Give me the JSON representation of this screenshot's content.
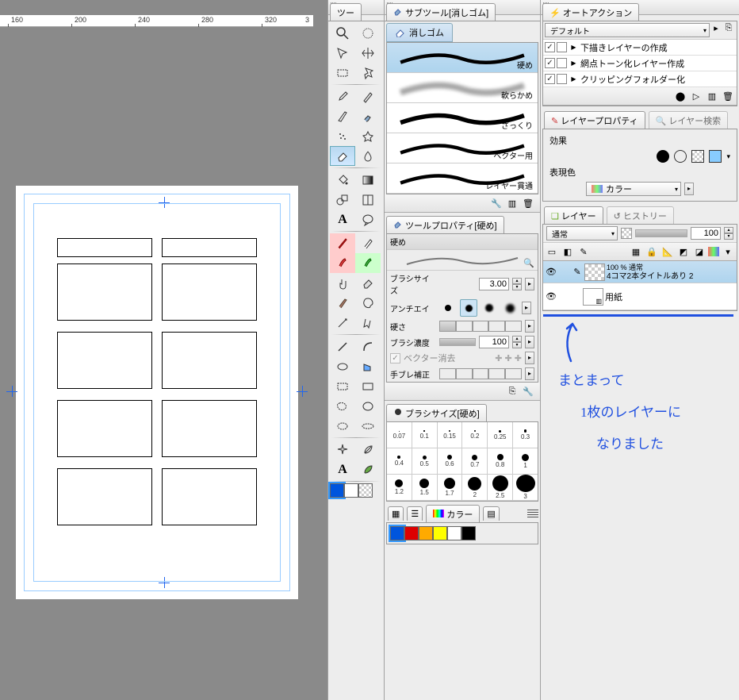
{
  "ruler": {
    "ticks": [
      "160",
      "200",
      "240",
      "280",
      "320"
    ]
  },
  "tool_panel": {
    "title": "ツー"
  },
  "subtool": {
    "title": "サブツール[消しゴム]",
    "tab": "消しゴム",
    "items": [
      "硬め",
      "軟らかめ",
      "ざっくり",
      "ベクター用",
      "レイヤー貫通"
    ]
  },
  "tool_property": {
    "title": "ツールプロパティ[硬め]",
    "preview_label": "硬め",
    "brush_size_label": "ブラシサイズ",
    "brush_size_value": "3.00",
    "antialias_label": "アンチエイ",
    "hardness_label": "硬さ",
    "density_label": "ブラシ濃度",
    "density_value": "100",
    "vector_erase_label": "ベクター消去",
    "shake_label": "手ブレ補正"
  },
  "brush_size_panel": {
    "title": "ブラシサイズ[硬め]",
    "rows": [
      [
        "0.07",
        "0.1",
        "0.15",
        "0.2",
        "0.25",
        "0.3"
      ],
      [
        "0.4",
        "0.5",
        "0.6",
        "0.7",
        "0.8",
        "1"
      ],
      [
        "1.2",
        "1.5",
        "1.7",
        "2",
        "2.5",
        "3"
      ]
    ]
  },
  "color_panel": {
    "title": "カラー"
  },
  "auto_action": {
    "title": "オートアクション",
    "set": "デフォルト",
    "items": [
      "下描きレイヤーの作成",
      "網点トーン化レイヤー作成",
      "クリッピングフォルダー化"
    ]
  },
  "layer_property": {
    "title": "レイヤープロパティ",
    "search_title": "レイヤー検索",
    "effect_label": "効果",
    "render_label": "表現色",
    "render_value": "カラー"
  },
  "layer_panel": {
    "title": "レイヤー",
    "history_title": "ヒストリー",
    "blend_mode": "通常",
    "opacity": "100",
    "layer1_opacity": "100 % 通常",
    "layer1_name": "4コマ2本タイトルあり 2",
    "paper_name": "用紙"
  },
  "annotation": {
    "l1": "まとまって",
    "l2": "1枚のレイヤーに",
    "l3": "なりました"
  }
}
